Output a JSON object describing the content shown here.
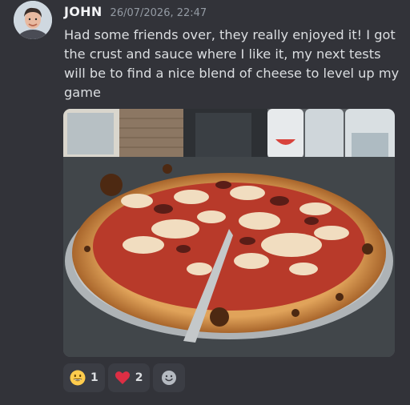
{
  "message": {
    "author": "JOHN",
    "timestamp": "26/07/2026, 22:47",
    "text": "Had some friends over, they really enjoyed it! I got the crust and sauce where I like it, my next tests will be to find a nice blend of cheese to level up my game"
  },
  "attachment": {
    "icon": "pizza-photo"
  },
  "reactions": [
    {
      "emoji": "grinning-face",
      "count": "1"
    },
    {
      "emoji": "red-heart",
      "count": "2"
    }
  ],
  "add_reaction": {
    "icon": "add-reaction-smiley-icon"
  },
  "colors": {
    "background": "#323339",
    "username": "#f2f3f5",
    "timestamp": "#949ba4",
    "text": "#dbdee1",
    "reaction_bg": "#3b3d44"
  }
}
